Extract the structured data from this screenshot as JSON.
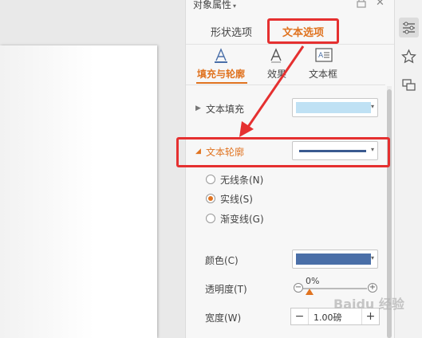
{
  "panel": {
    "title": "对象属性",
    "tabs": [
      {
        "label": "形状选项",
        "active": false
      },
      {
        "label": "文本选项",
        "active": true
      }
    ],
    "subtabs": [
      {
        "label": "填充与轮廓",
        "icon": "text-fill-icon",
        "active": true
      },
      {
        "label": "效果",
        "icon": "text-effect-icon",
        "active": false
      },
      {
        "label": "文本框",
        "icon": "text-box-icon",
        "active": false
      }
    ],
    "text_fill": {
      "label": "文本填充",
      "color": "#bfe1f4"
    },
    "text_outline": {
      "label": "文本轮廓",
      "options": [
        {
          "label": "无线条(N)",
          "checked": false
        },
        {
          "label": "实线(S)",
          "checked": true
        },
        {
          "label": "渐变线(G)",
          "checked": false
        }
      ],
      "color_label": "颜色(C)",
      "color": "#4a6fa8",
      "transparency_label": "透明度(T)",
      "transparency_value": "0%",
      "width_label": "宽度(W)",
      "width_value": "1.00磅"
    }
  },
  "accent_color": "#e07320",
  "highlight_color": "#e53030",
  "watermark": "Baidu 经验"
}
